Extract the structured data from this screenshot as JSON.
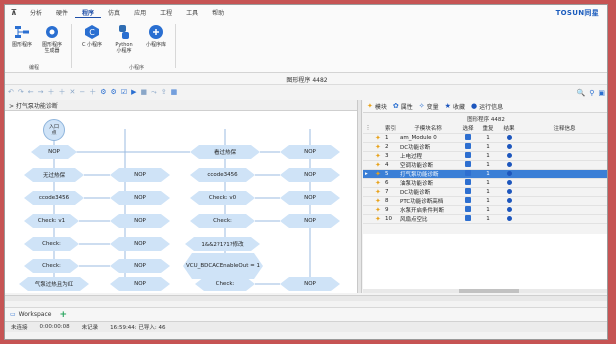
{
  "menu": [
    "分析",
    "硬件",
    "程序",
    "仿真",
    "应用",
    "工程",
    "工具",
    "帮助"
  ],
  "brand": "TOSUN同星",
  "ribbon": {
    "buttons": [
      "图形程序",
      "图形程序\n生成器",
      "C 小程序",
      "Python\n小程序",
      "小程序库"
    ],
    "groups": [
      "编程",
      "小程序"
    ]
  },
  "doc_title": "图形程序 4482",
  "canvas_title": "> 打气泵功能诊断",
  "flow": {
    "start": "入口\n点",
    "nodes": [
      "NOP",
      "看过热保",
      "NOP",
      "无过热保",
      "NOP",
      "ccode3456",
      "NOP",
      "ccode3456",
      "NOP",
      "Check: v0",
      "NOP",
      "Check: v1",
      "NOP",
      "Check:",
      "NOP",
      "Check:",
      "NOP",
      "1&&2?1?1?修改",
      "Check:",
      "NOP",
      "VCU_BDCACEnableOut = 1",
      "气泵过热且为红",
      "NOP",
      "Check:",
      "NOP"
    ]
  },
  "right_tabs": [
    "模块",
    "属性",
    "变量",
    "收藏",
    "运行信息"
  ],
  "grid": {
    "title": "图形程序 4482",
    "headers": [
      "索引",
      "子模块名称",
      "选择",
      "重复",
      "结果",
      "注释信息"
    ],
    "rows": [
      {
        "idx": "1",
        "name": "am_Module 0",
        "repeat": "1"
      },
      {
        "idx": "2",
        "name": "DC功能诊断",
        "repeat": "1"
      },
      {
        "idx": "3",
        "name": "上电过程",
        "repeat": "1"
      },
      {
        "idx": "4",
        "name": "空调功能诊断",
        "repeat": "1"
      },
      {
        "idx": "5",
        "name": "打气泵功能诊断",
        "repeat": "1"
      },
      {
        "idx": "6",
        "name": "油泵功能诊断",
        "repeat": "1"
      },
      {
        "idx": "7",
        "name": "DC功能诊断",
        "repeat": "1"
      },
      {
        "idx": "8",
        "name": "PTC功能诊断高档",
        "repeat": "1"
      },
      {
        "idx": "9",
        "name": "水泵开启条件判断",
        "repeat": "1"
      },
      {
        "idx": "10",
        "name": "风扇点空比",
        "repeat": "1"
      }
    ],
    "selected_index": 4
  },
  "workspace": {
    "label": "Workspace"
  },
  "status": {
    "connection": "未连接",
    "time": "0:00:00:08",
    "record": "未记录",
    "clock": "16:59:44: 已导入: 46"
  },
  "colors": {
    "accent": "#1f4fa8",
    "node": "#cfe3f7",
    "selected_row": "#3b7fd6",
    "frame": "#c65454"
  }
}
